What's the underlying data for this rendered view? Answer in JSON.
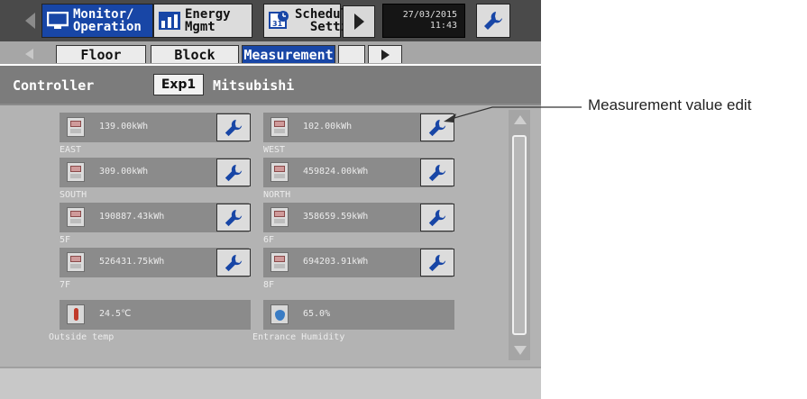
{
  "topbar": {
    "monitor_label": "Monitor/\nOperation",
    "energy_label": "Energy\nMgmt",
    "schedule_label": "Schedule\n  Settings",
    "schedule_icon_text": "31",
    "date": "27/03/2015",
    "time": "11:43"
  },
  "tabs": [
    {
      "label": "Floor"
    },
    {
      "label": "Block"
    },
    {
      "label": "Measurement"
    }
  ],
  "group": {
    "label": "Controller",
    "button": "Exp1",
    "name": "Mitsubishi"
  },
  "measurements": [
    {
      "value": "139.00kWh",
      "name": "EAST"
    },
    {
      "value": "102.00kWh",
      "name": "WEST"
    },
    {
      "value": "309.00kWh",
      "name": "SOUTH"
    },
    {
      "value": "459824.00kWh",
      "name": "NORTH"
    },
    {
      "value": "190887.43kWh",
      "name": "5F"
    },
    {
      "value": "358659.59kWh",
      "name": "6F"
    },
    {
      "value": "526431.75kWh",
      "name": "7F"
    },
    {
      "value": "694203.91kWh",
      "name": "8F"
    },
    {
      "value": "24.5℃",
      "name": "Outside temp"
    },
    {
      "value": "65.0%",
      "name": "Entrance Humidity"
    }
  ],
  "annotation": "Measurement value edit",
  "colors": {
    "accent": "#1846a6",
    "topbar": "#4a4a4a",
    "panel": "#b3b3b3"
  }
}
